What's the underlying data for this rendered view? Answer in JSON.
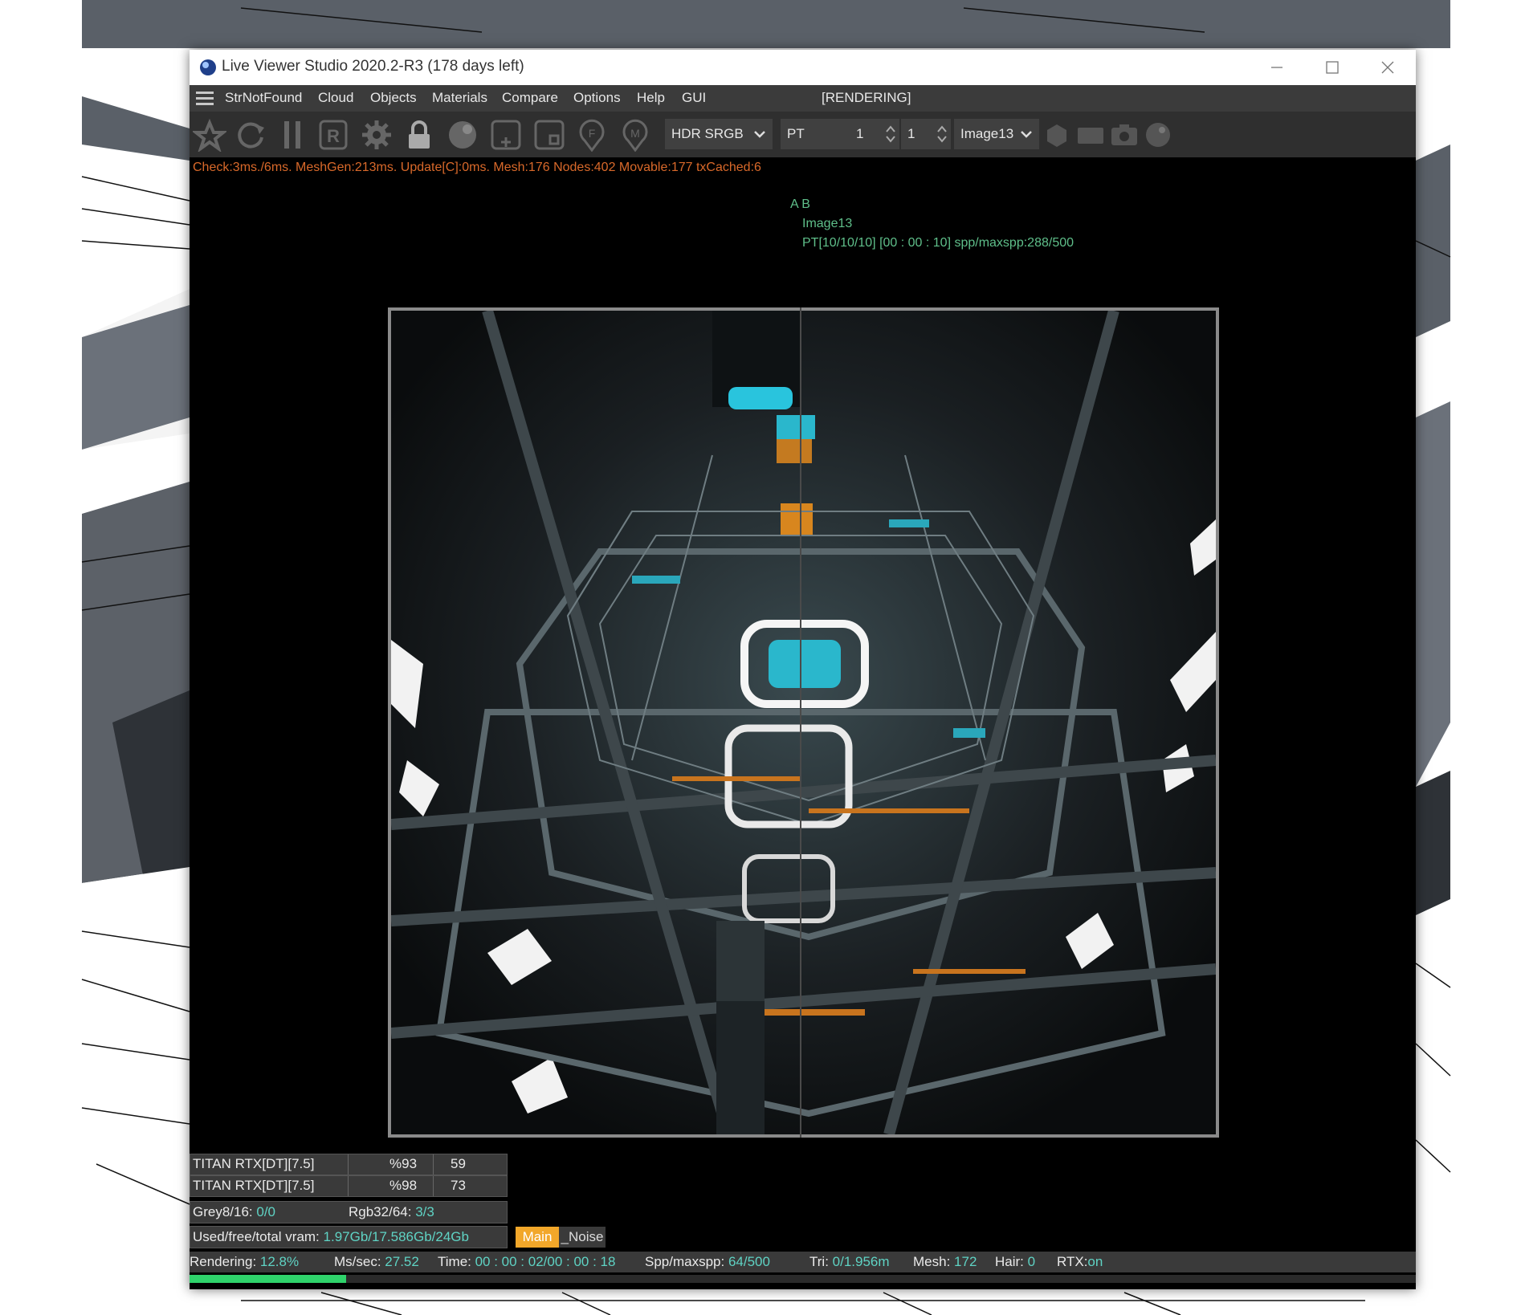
{
  "window": {
    "title": "Live Viewer Studio 2020.2-R3 (178 days left)"
  },
  "menu": {
    "items": [
      "StrNotFound",
      "Cloud",
      "Objects",
      "Materials",
      "Compare",
      "Options",
      "Help",
      "GUI"
    ],
    "status": "[RENDERING]"
  },
  "toolbar": {
    "icons": [
      "render-kernel-icon",
      "refresh-icon",
      "pause-icon",
      "r-icon",
      "gear-icon",
      "lock-icon",
      "sphere-icon",
      "add-square-icon",
      "region-icon",
      "f-pin-icon",
      "m-pin-icon"
    ],
    "colorspace": "HDR SRGB",
    "kernel": "PT",
    "spin1": "1",
    "spin2": "1",
    "image": "Image13",
    "right_icons": [
      "hexagon-icon",
      "rectangle-icon",
      "camera-icon",
      "ball-icon"
    ]
  },
  "stats_line": "Check:3ms./6ms. MeshGen:213ms. Update[C]:0ms. Mesh:176 Nodes:402 Movable:177 txCached:6",
  "overlay": {
    "ab": "A  B",
    "image_name": "Image13",
    "progress_info": "PT[10/10/10] [00 : 00 : 10] spp/maxspp:288/500"
  },
  "gpus": [
    {
      "name": "TITAN RTX[DT][7.5]",
      "util": "%93",
      "temp": "59"
    },
    {
      "name": "TITAN RTX[DT][7.5]",
      "util": "%98",
      "temp": "73"
    }
  ],
  "textures": {
    "grey_label": "Grey8/16: ",
    "grey_value": "0/0",
    "rgb_label": "Rgb32/64: ",
    "rgb_value": "3/3"
  },
  "vram": {
    "label": "Used/free/total vram: ",
    "value": "1.97Gb/17.586Gb/24Gb"
  },
  "tabs": {
    "main": "Main",
    "noise": "_Noise"
  },
  "status": {
    "rendering_label": "Rendering: ",
    "rendering_value": "12.8%",
    "mssec_label": "Ms/sec: ",
    "mssec_value": "27.52",
    "time_label": "Time: ",
    "time_value": "00 : 00 : 02/00 : 00 : 18",
    "spp_label": "Spp/maxspp: ",
    "spp_value": "64/500",
    "tri_label": "Tri: ",
    "tri_value": "0/1.956m",
    "mesh_label": "Mesh: ",
    "mesh_value": "172",
    "hair_label": "Hair: ",
    "hair_value": "0",
    "rtx_label": "RTX:",
    "rtx_value": "on"
  },
  "render_progress_fraction": 0.128,
  "colors": {
    "accent_orange": "#f2a72a",
    "value_teal": "#5fd3c4",
    "overlay_green": "#5fbf8a",
    "stats_orange": "#d9692a",
    "progress_green": "#2fd36b"
  }
}
